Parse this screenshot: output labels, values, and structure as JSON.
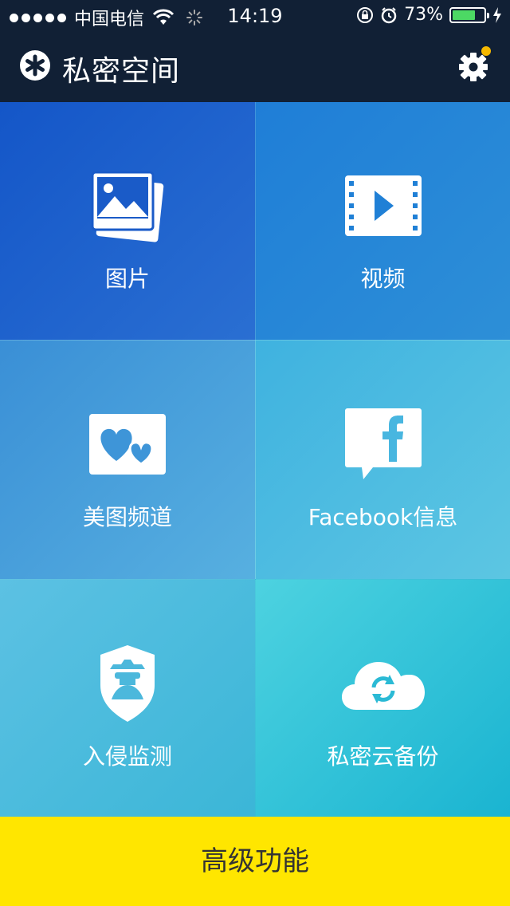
{
  "status_bar": {
    "carrier": "中国电信",
    "time": "14:19",
    "battery_percent_text": "73%",
    "battery_level": 0.73
  },
  "navbar": {
    "title": "私密空间"
  },
  "tiles": [
    {
      "label": "图片",
      "icon": "photos-icon"
    },
    {
      "label": "视频",
      "icon": "video-icon"
    },
    {
      "label": "美图频道",
      "icon": "hearts-icon"
    },
    {
      "label": "Facebook信息",
      "icon": "facebook-icon"
    },
    {
      "label": "入侵监测",
      "icon": "intruder-shield-icon"
    },
    {
      "label": "私密云备份",
      "icon": "cloud-sync-icon"
    }
  ],
  "premium_button": {
    "label": "高级功能"
  },
  "colors": {
    "navbar_bg": "#112035",
    "premium_bg": "#ffe600",
    "notification_dot": "#f5b800"
  }
}
